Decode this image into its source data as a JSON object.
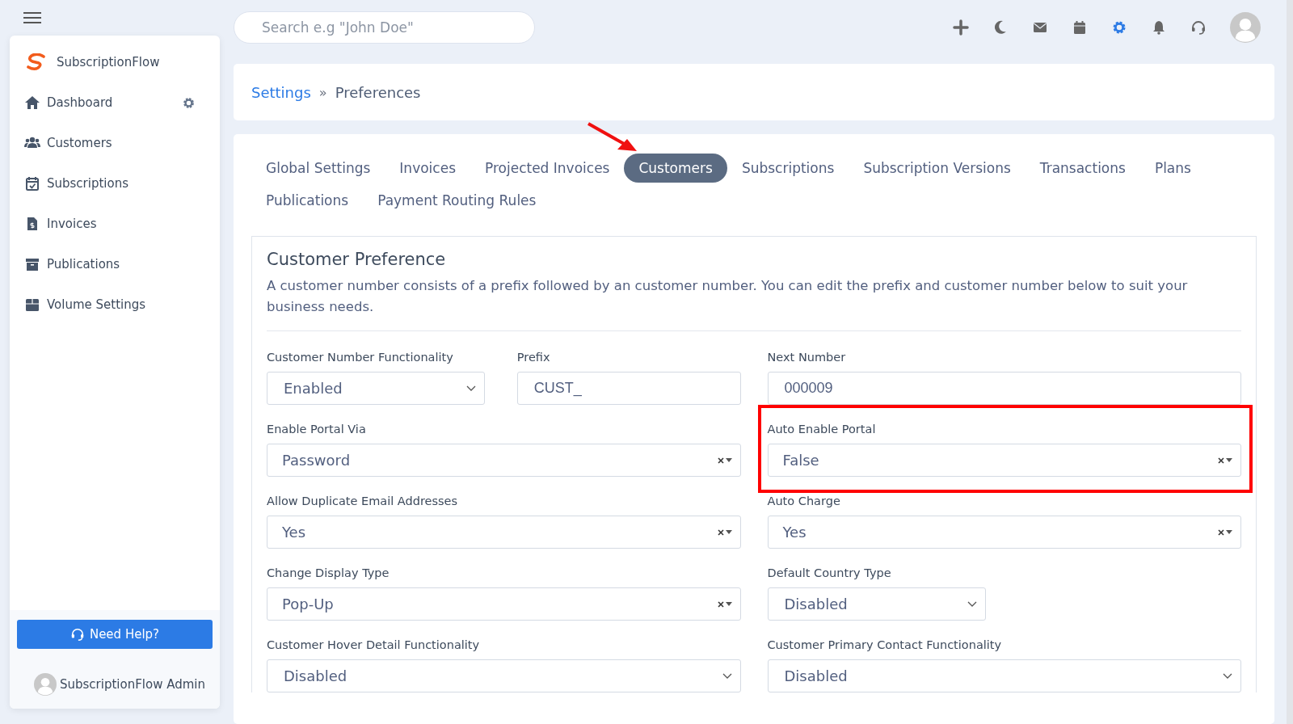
{
  "search": {
    "placeholder": "Search e.g \"John Doe\""
  },
  "sidebar": {
    "brand": "SubscriptionFlow",
    "items": [
      {
        "label": "Dashboard",
        "settings": true
      },
      {
        "label": "Customers",
        "settings": false
      },
      {
        "label": "Subscriptions",
        "settings": false
      },
      {
        "label": "Invoices",
        "settings": false
      },
      {
        "label": "Publications",
        "settings": false
      },
      {
        "label": "Volume Settings",
        "settings": false
      }
    ],
    "help_button": "Need Help?",
    "user": "SubscriptionFlow Admin"
  },
  "toolbar": [
    {
      "active": false
    },
    {
      "active": false
    },
    {
      "active": false
    },
    {
      "active": false
    },
    {
      "active": true
    },
    {
      "active": false
    },
    {
      "active": false
    }
  ],
  "breadcrumb": {
    "link": "Settings",
    "separator": "»",
    "current": "Preferences"
  },
  "tabs": [
    {
      "label": "Global Settings",
      "selected": false,
      "annotated": false
    },
    {
      "label": "Invoices",
      "selected": false,
      "annotated": false
    },
    {
      "label": "Projected Invoices",
      "selected": false,
      "annotated": false
    },
    {
      "label": "Customers",
      "selected": true,
      "annotated": true
    },
    {
      "label": "Subscriptions",
      "selected": false,
      "annotated": false
    },
    {
      "label": "Subscription Versions",
      "selected": false,
      "annotated": false
    },
    {
      "label": "Transactions",
      "selected": false,
      "annotated": false
    },
    {
      "label": "Plans",
      "selected": false,
      "annotated": false
    },
    {
      "label": "Publications",
      "selected": false,
      "annotated": false
    },
    {
      "label": "Payment Routing Rules",
      "selected": false,
      "annotated": false
    }
  ],
  "section": {
    "title": "Customer Preference",
    "description": "A customer number consists of a prefix followed by an customer number. You can edit the prefix and customer number below to suit your business needs.",
    "fields": [
      {
        "label": "Customer Number Functionality",
        "kind": "select",
        "value": "Enabled",
        "highlighted": false
      },
      {
        "label": "Prefix",
        "kind": "text",
        "value": "CUST_",
        "highlighted": false
      },
      {
        "label": "Next Number",
        "kind": "text",
        "value": "000009",
        "highlighted": false
      },
      {
        "label": "Enable Portal Via",
        "kind": "select2",
        "value": "Password",
        "highlighted": false
      },
      {
        "label": "Auto Enable Portal",
        "kind": "select2",
        "value": "False",
        "highlighted": true
      },
      {
        "label": "Allow Duplicate Email Addresses",
        "kind": "select2",
        "value": "Yes",
        "highlighted": false
      },
      {
        "label": "Auto Charge",
        "kind": "select2",
        "value": "Yes",
        "highlighted": false
      },
      {
        "label": "Change Display Type",
        "kind": "select2",
        "value": "Pop-Up",
        "highlighted": false
      },
      {
        "label": "Default Country Type",
        "kind": "dropdown",
        "value": "Disabled",
        "highlighted": false
      },
      {
        "label": "Customer Hover Detail Functionality",
        "kind": "select",
        "value": "Disabled",
        "highlighted": false
      },
      {
        "label": "Customer Primary Contact Functionality",
        "kind": "select",
        "value": "Disabled",
        "highlighted": false
      }
    ]
  }
}
